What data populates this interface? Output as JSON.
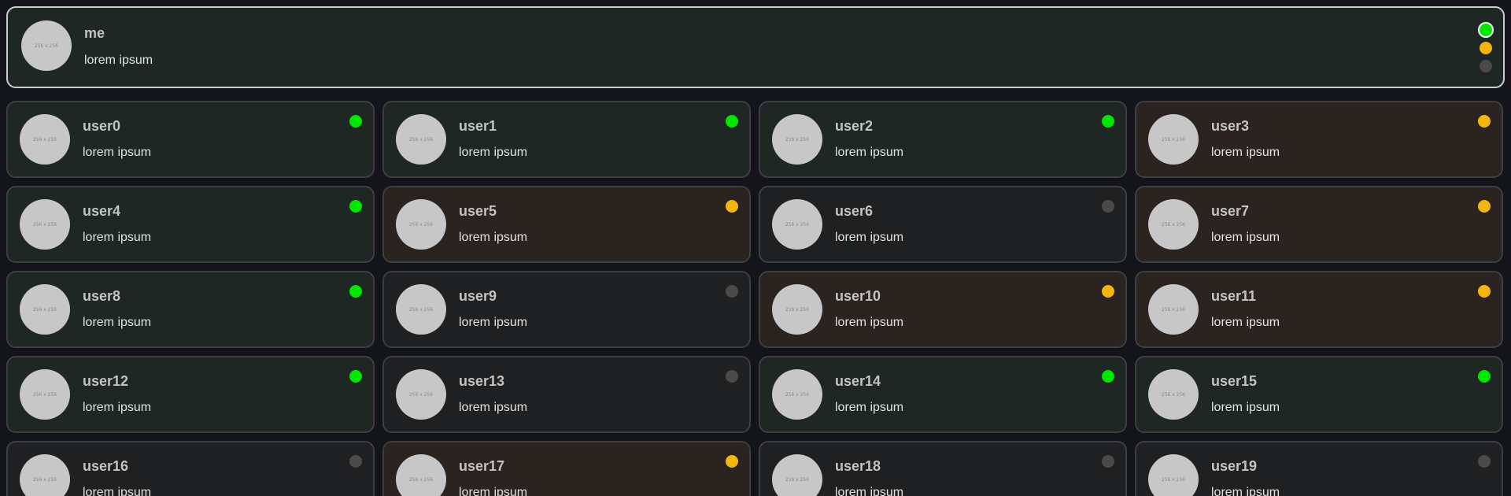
{
  "colors": {
    "online": "#00e600",
    "away": "#f5b50f",
    "offline": "#4a4a4a",
    "card_online_bg": "#1f2724",
    "card_away_bg": "#2a231f",
    "card_offline_bg": "#1f2022"
  },
  "me": {
    "name": "me",
    "status_text": "lorem ipsum",
    "avatar_text": "256 x 256",
    "status": "online",
    "status_options": [
      "online",
      "away",
      "offline"
    ]
  },
  "users": [
    {
      "name": "user0",
      "status_text": "lorem ipsum",
      "avatar_text": "256 x 256",
      "status": "online"
    },
    {
      "name": "user1",
      "status_text": "lorem ipsum",
      "avatar_text": "256 x 256",
      "status": "online"
    },
    {
      "name": "user2",
      "status_text": "lorem ipsum",
      "avatar_text": "256 x 256",
      "status": "online"
    },
    {
      "name": "user3",
      "status_text": "lorem ipsum",
      "avatar_text": "256 x 256",
      "status": "away"
    },
    {
      "name": "user4",
      "status_text": "lorem ipsum",
      "avatar_text": "256 x 256",
      "status": "online"
    },
    {
      "name": "user5",
      "status_text": "lorem ipsum",
      "avatar_text": "256 x 256",
      "status": "away"
    },
    {
      "name": "user6",
      "status_text": "lorem ipsum",
      "avatar_text": "256 x 256",
      "status": "offline"
    },
    {
      "name": "user7",
      "status_text": "lorem ipsum",
      "avatar_text": "256 x 256",
      "status": "away"
    },
    {
      "name": "user8",
      "status_text": "lorem ipsum",
      "avatar_text": "256 x 256",
      "status": "online"
    },
    {
      "name": "user9",
      "status_text": "lorem ipsum",
      "avatar_text": "256 x 256",
      "status": "offline"
    },
    {
      "name": "user10",
      "status_text": "lorem ipsum",
      "avatar_text": "256 x 256",
      "status": "away"
    },
    {
      "name": "user11",
      "status_text": "lorem ipsum",
      "avatar_text": "256 x 256",
      "status": "away"
    },
    {
      "name": "user12",
      "status_text": "lorem ipsum",
      "avatar_text": "256 x 256",
      "status": "online"
    },
    {
      "name": "user13",
      "status_text": "lorem ipsum",
      "avatar_text": "256 x 256",
      "status": "offline"
    },
    {
      "name": "user14",
      "status_text": "lorem ipsum",
      "avatar_text": "256 x 256",
      "status": "online"
    },
    {
      "name": "user15",
      "status_text": "lorem ipsum",
      "avatar_text": "256 x 256",
      "status": "online"
    },
    {
      "name": "user16",
      "status_text": "lorem ipsum",
      "avatar_text": "256 x 256",
      "status": "offline"
    },
    {
      "name": "user17",
      "status_text": "lorem ipsum",
      "avatar_text": "256 x 256",
      "status": "away"
    },
    {
      "name": "user18",
      "status_text": "lorem ipsum",
      "avatar_text": "256 x 256",
      "status": "offline"
    },
    {
      "name": "user19",
      "status_text": "lorem ipsum",
      "avatar_text": "256 x 256",
      "status": "offline"
    }
  ]
}
